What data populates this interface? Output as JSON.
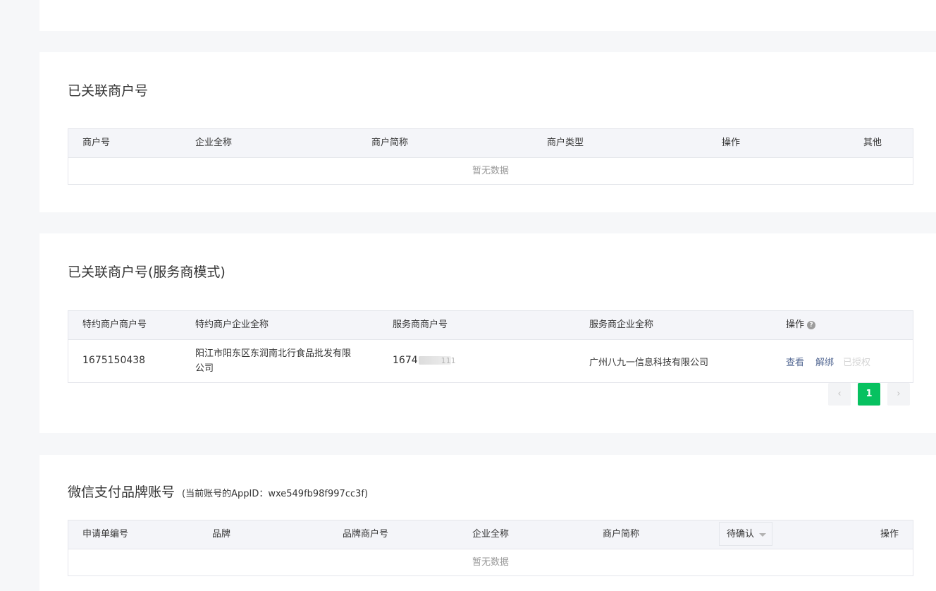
{
  "section1": {
    "title": "已关联商户号",
    "columns": [
      "商户号",
      "企业全称",
      "商户简称",
      "商户类型",
      "操作",
      "其他"
    ],
    "empty_text": "暂无数据"
  },
  "section2": {
    "title": "已关联商户号(服务商模式)",
    "columns": [
      "特约商户商户号",
      "特约商户企业全称",
      "服务商商户号",
      "服务商企业全称",
      "操作"
    ],
    "rows": [
      {
        "sub_mch_id": "1675150438",
        "sub_company_line1": "阳江市阳东区东润南北行食品批发有限",
        "sub_company_line2": "公司",
        "sp_mch_id_visible": "1674",
        "sp_mch_id_tail": "111",
        "sp_company": "广州八九一信息科技有限公司",
        "action_view": "查看",
        "action_unbind": "解绑",
        "action_authorized": "已授权"
      }
    ],
    "pagination": {
      "prev": "‹",
      "current": "1",
      "next": "›"
    }
  },
  "section3": {
    "title": "微信支付品牌账号",
    "subtitle": "(当前账号的AppID：wxe549fb98f997cc3f)",
    "columns": [
      "申请单编号",
      "品牌",
      "品牌商户号",
      "企业全称",
      "商户简称",
      "操作"
    ],
    "status_filter": "待确认",
    "empty_text": "暂无数据"
  },
  "colors": {
    "accent": "#07c160",
    "link": "#576b95",
    "header_bg": "#f4f5f9",
    "page_bg": "#f6f7f9"
  }
}
